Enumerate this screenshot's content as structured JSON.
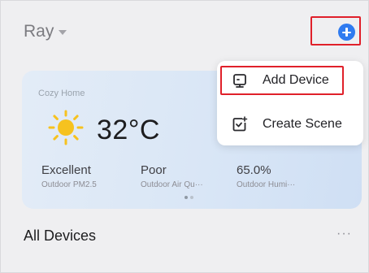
{
  "header": {
    "home_name": "Ray"
  },
  "weather": {
    "home_label": "Cozy Home",
    "temperature": "32°C",
    "stats": [
      {
        "value": "Excellent",
        "label": "Outdoor PM2.5"
      },
      {
        "value": "Poor",
        "label": "Outdoor Air Qu···"
      },
      {
        "value": "65.0%",
        "label": "Outdoor Humi···"
      }
    ]
  },
  "menu": {
    "add_device": "Add Device",
    "create_scene": "Create Scene"
  },
  "devices": {
    "title": "All Devices",
    "more": "···"
  },
  "colors": {
    "accent": "#2f7bf0",
    "highlight_box": "#e0202a",
    "sun": "#f6c21f"
  }
}
